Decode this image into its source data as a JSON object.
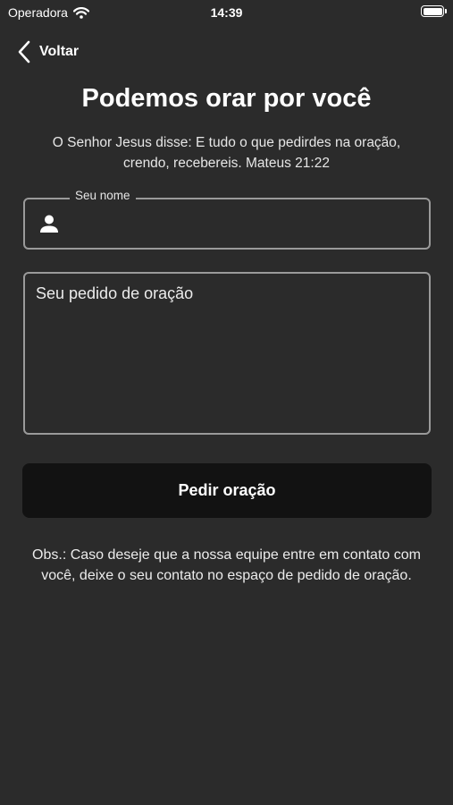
{
  "status_bar": {
    "carrier": "Operadora",
    "time": "14:39"
  },
  "nav": {
    "back_label": "Voltar"
  },
  "header": {
    "title": "Podemos orar por você",
    "verse": "O Senhor Jesus disse: E tudo o que pedirdes na oração, crendo, recebereis. Mateus 21:22"
  },
  "form": {
    "name_label": "Seu nome",
    "name_value": "",
    "request_placeholder": "Seu pedido de oração",
    "request_value": "",
    "submit_label": "Pedir oração"
  },
  "footer": {
    "note": "Obs.:  Caso deseje que a nossa equipe entre em contato com você, deixe o seu contato no espaço de pedido de oração."
  },
  "icons": {
    "back": "chevron-left-icon",
    "name_field": "person-icon",
    "wifi": "wifi-icon",
    "battery": "battery-icon"
  },
  "colors": {
    "background": "#2b2b2b",
    "field_border": "#9a9a9a",
    "button_background": "#121212",
    "text": "#ffffff"
  }
}
